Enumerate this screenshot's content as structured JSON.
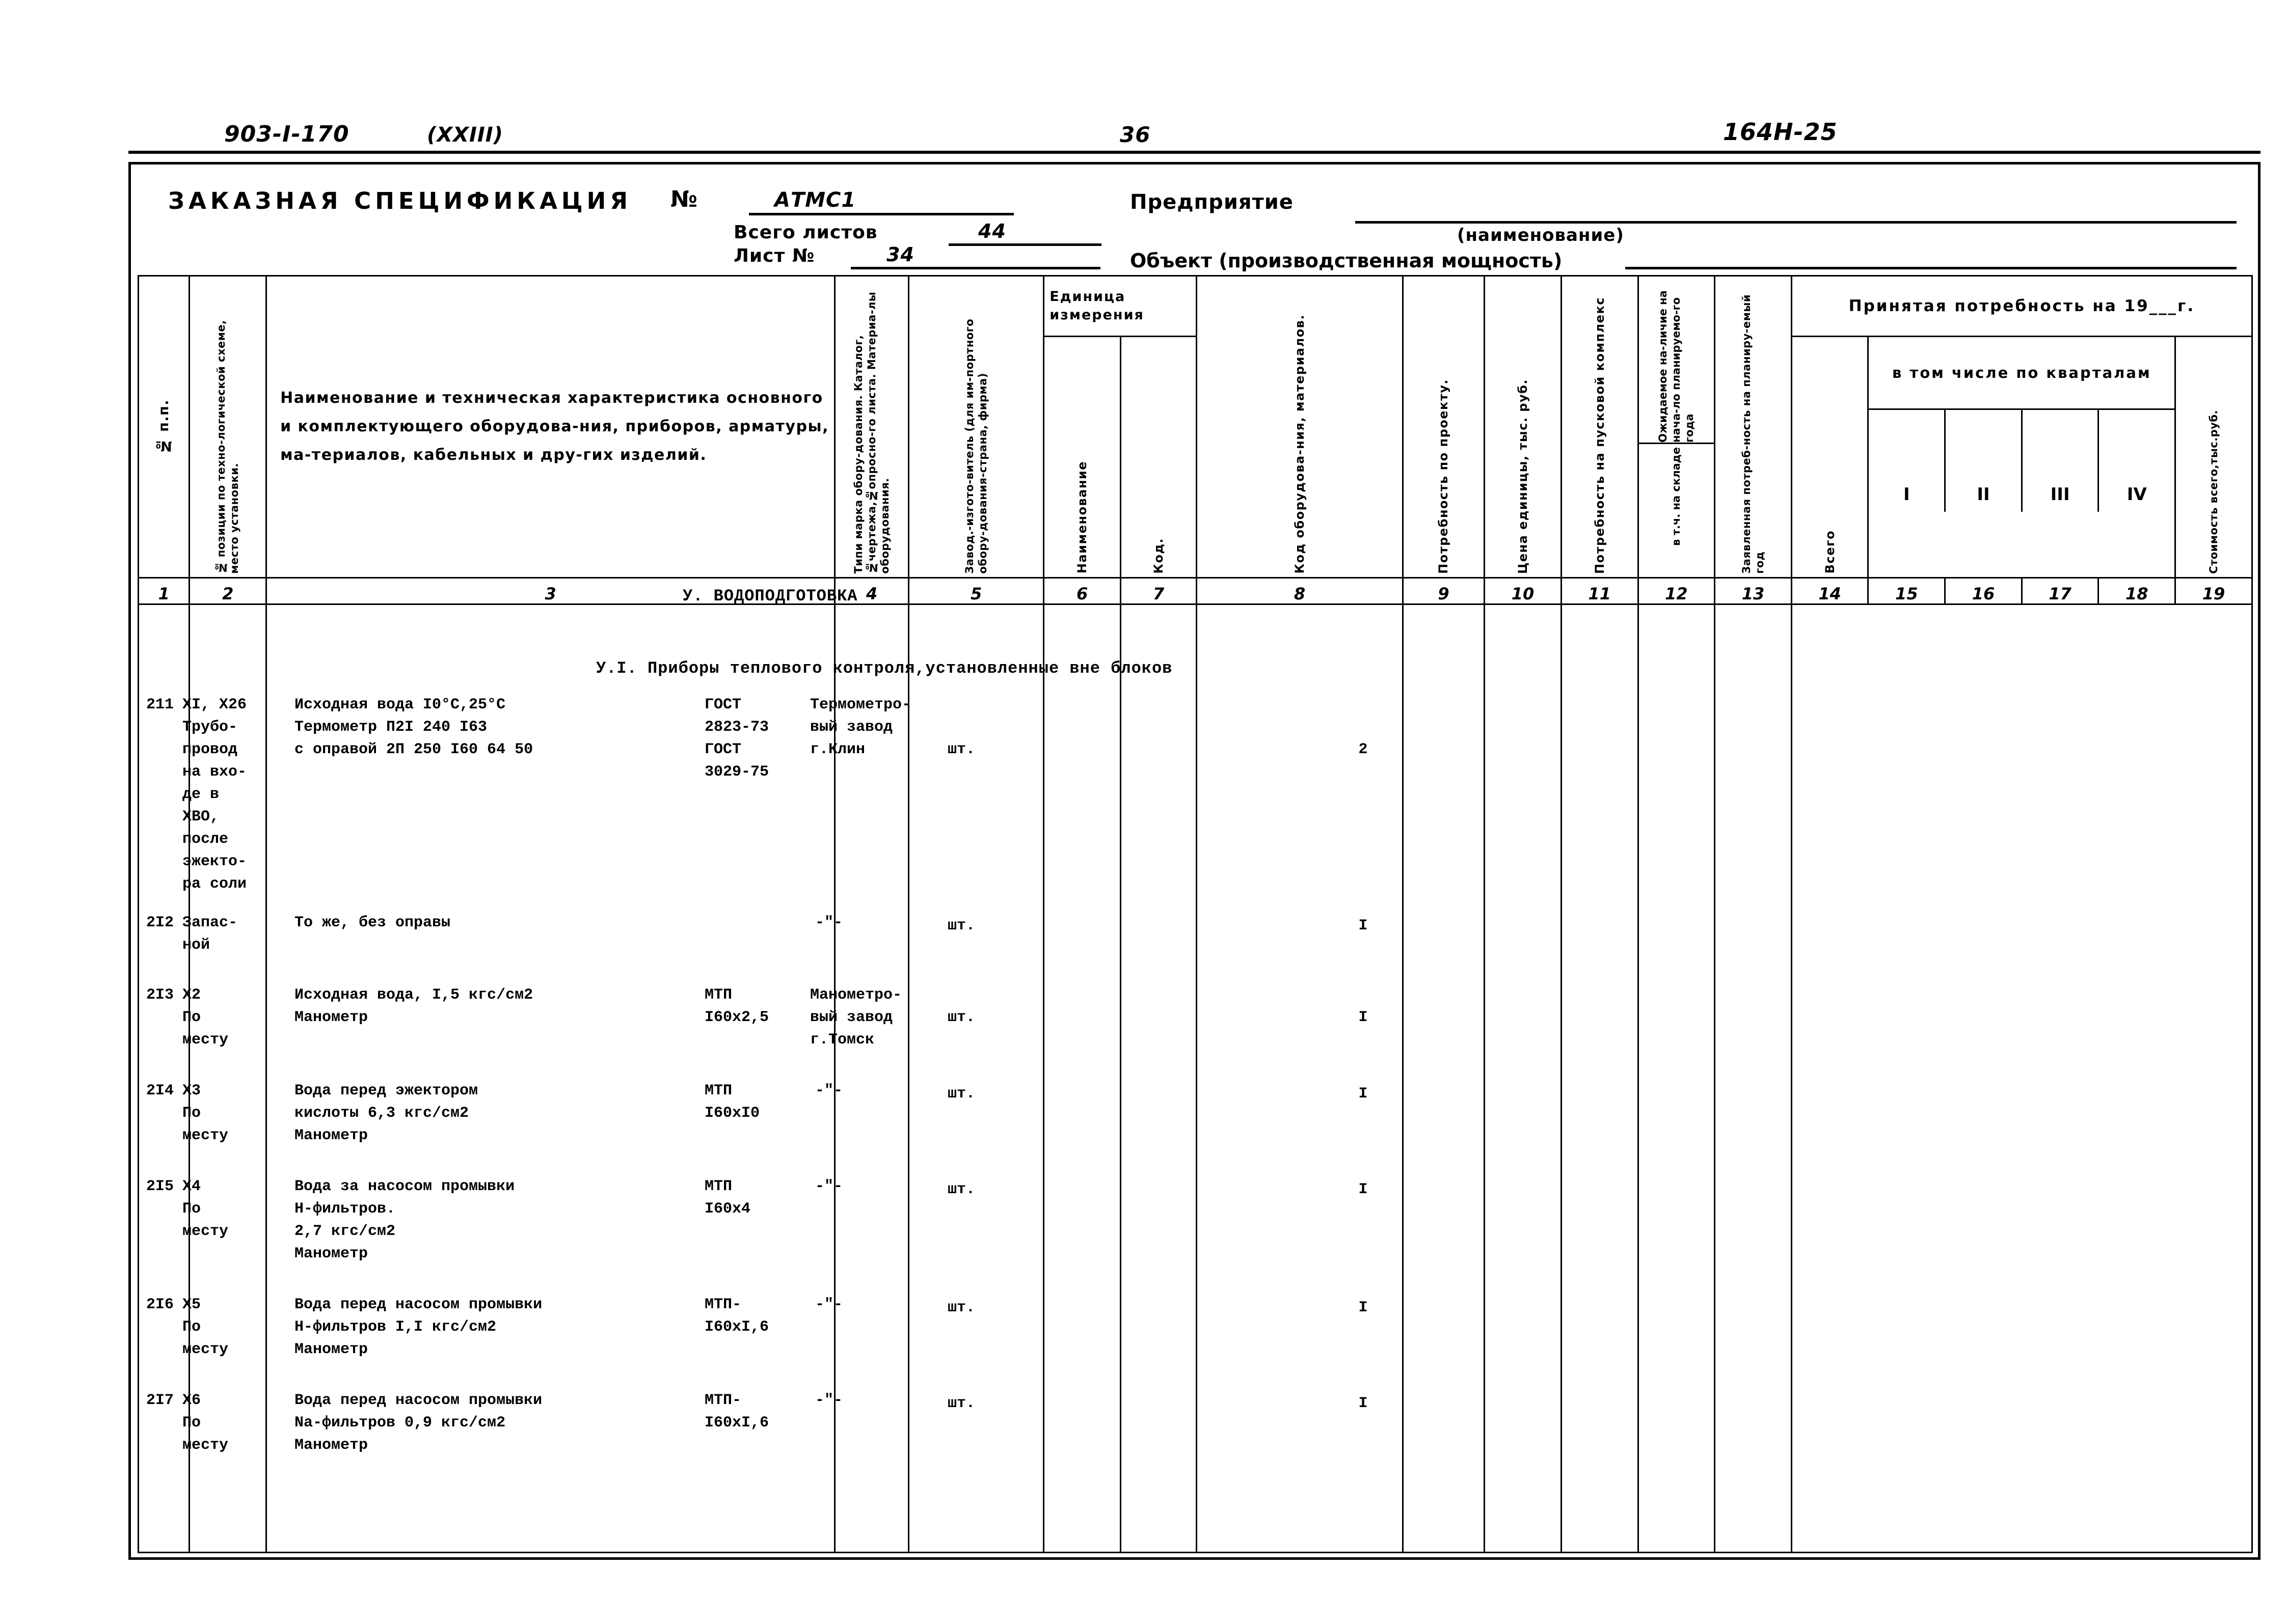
{
  "page_header": {
    "doc_code": "903-I-170",
    "volume": "(XXIII)",
    "page_number": "36",
    "sheet_code": "164H-25"
  },
  "form": {
    "title": "ЗАКАЗНАЯ СПЕЦИФИКАЦИЯ",
    "number_label": "№",
    "number_value": "АТМС1",
    "total_sheets_label": "Всего листов",
    "total_sheets_value": "44",
    "sheet_no_label": "Лист №",
    "sheet_no_value": "34",
    "enterprise_label": "Предприятие",
    "enterprise_hint": "(наименование)",
    "object_label": "Объект (производственная мощность)"
  },
  "table": {
    "headers": {
      "col1": "№ п.п.",
      "col2": "№ позиции по техно-логической схеме, место установки.",
      "col3": "Наименование и техническая характеристика основного и комплектующего оборудова-ния, приборов, арматуры, ма-териалов, кабельных и дру-гих изделий.",
      "col4": "Типи марка обору-дования. Каталог, №чертежа,№опросно-го листа. Материа-лы оборудования.",
      "col5": "Завод.-изгото-витель (для им-портного обору-дования-страна, фирма)",
      "unit_group": "Единица измерения",
      "col6": "Наименование",
      "col7": "Код.",
      "col8": "Код оборудова-ния, материалов.",
      "col9": "Потребность по проекту.",
      "col10": "Цена единицы, тыс. руб.",
      "col11": "Потребность на пусковой комплекс",
      "col12": "Ожидаемое на-личие на нача-ло планируемо-го года",
      "col12b": "в т.ч. на складе",
      "col13": "Заявленная потреб-ность на планиру-емый год",
      "accepted_group": "Принятая потребность на 19___г.",
      "col14": "Всего",
      "quarters_group": "в том числе по кварталам",
      "col15": "I",
      "col16": "II",
      "col17": "III",
      "col18": "IV",
      "col19": "Стоимость всего,тыс.руб."
    },
    "column_numbers": [
      "1",
      "2",
      "3",
      "4",
      "5",
      "6",
      "7",
      "8",
      "9",
      "10",
      "11",
      "12",
      "13",
      "14",
      "15",
      "16",
      "17",
      "18",
      "19"
    ],
    "sections": [
      {
        "title": "У. ВОДОПОДГОТОВКА"
      },
      {
        "title": "У.I. Приборы теплового контроля,установленные вне блоков"
      }
    ],
    "rows": [
      {
        "no": "211",
        "position": "XI, X26\nТрубо-\nпровод\nна вхо-\nде в\nХВО,\nпосле\nэжекто-\nра соли",
        "description": "Исходная вода I0°C,25°C\nТермометр П2I 240 I63\nс оправой 2П 250 I60 64 50",
        "type_mark": "ГОСТ\n2823-73\nГОСТ\n3029-75",
        "manufacturer": "Термометро-\nвый завод\nг.Клин",
        "unit": "шт.",
        "code": "",
        "equipment_code": "",
        "qty_project": "2",
        "unit_price": "",
        "startup_need": "",
        "expected": "",
        "in_stock": "",
        "declared": "",
        "total": "",
        "q1": "",
        "q2": "",
        "q3": "",
        "q4": "",
        "cost": ""
      },
      {
        "no": "2I2",
        "position": "Запас-\nной",
        "description": "То же, без оправы",
        "type_mark": "",
        "manufacturer": "-\"-",
        "unit": "шт.",
        "code": "",
        "equipment_code": "",
        "qty_project": "I",
        "unit_price": "",
        "startup_need": "",
        "expected": "",
        "in_stock": "",
        "declared": "",
        "total": "",
        "q1": "",
        "q2": "",
        "q3": "",
        "q4": "",
        "cost": ""
      },
      {
        "no": "2I3",
        "position": "X2\nПо\nместу",
        "description": "Исходная вода, I,5 кгс/см2\nМанометр",
        "type_mark": "МТП\nI60x2,5",
        "manufacturer": "Манометро-\nвый завод\nг.Томск",
        "unit": "шт.",
        "code": "",
        "equipment_code": "",
        "qty_project": "I",
        "unit_price": "",
        "startup_need": "",
        "expected": "",
        "in_stock": "",
        "declared": "",
        "total": "",
        "q1": "",
        "q2": "",
        "q3": "",
        "q4": "",
        "cost": ""
      },
      {
        "no": "2I4",
        "position": "X3\nПо\nместу",
        "description": "Вода перед эжектором\nкислоты 6,3 кгс/см2\nМанометр",
        "type_mark": "МТП\nI60xI0",
        "manufacturer": "-\"-",
        "unit": "шт.",
        "code": "",
        "equipment_code": "",
        "qty_project": "I",
        "unit_price": "",
        "startup_need": "",
        "expected": "",
        "in_stock": "",
        "declared": "",
        "total": "",
        "q1": "",
        "q2": "",
        "q3": "",
        "q4": "",
        "cost": ""
      },
      {
        "no": "2I5",
        "position": "X4\nПо\nместу",
        "description": "Вода за насосом промывки\nН-фильтров.\n2,7 кгс/см2\nМанометр",
        "type_mark": "МТП\nI60x4",
        "manufacturer": "-\"-",
        "unit": "шт.",
        "code": "",
        "equipment_code": "",
        "qty_project": "I",
        "unit_price": "",
        "startup_need": "",
        "expected": "",
        "in_stock": "",
        "declared": "",
        "total": "",
        "q1": "",
        "q2": "",
        "q3": "",
        "q4": "",
        "cost": ""
      },
      {
        "no": "2I6",
        "position": "X5\nПо\nместу",
        "description": "Вода перед насосом промывки\nН-фильтров I,I кгс/см2\nМанометр",
        "type_mark": "МТП-\nI60xI,6",
        "manufacturer": "-\"-",
        "unit": "шт.",
        "code": "",
        "equipment_code": "",
        "qty_project": "I",
        "unit_price": "",
        "startup_need": "",
        "expected": "",
        "in_stock": "",
        "declared": "",
        "total": "",
        "q1": "",
        "q2": "",
        "q3": "",
        "q4": "",
        "cost": ""
      },
      {
        "no": "2I7",
        "position": "X6\nПо\nместу",
        "description": "Вода перед насосом промывки\nNa-фильтров 0,9 кгс/см2\nМанометр",
        "type_mark": "МТП-\nI60xI,6",
        "manufacturer": "-\"-",
        "unit": "шт.",
        "code": "",
        "equipment_code": "",
        "qty_project": "I",
        "unit_price": "",
        "startup_need": "",
        "expected": "",
        "in_stock": "",
        "declared": "",
        "total": "",
        "q1": "",
        "q2": "",
        "q3": "",
        "q4": "",
        "cost": ""
      }
    ]
  }
}
